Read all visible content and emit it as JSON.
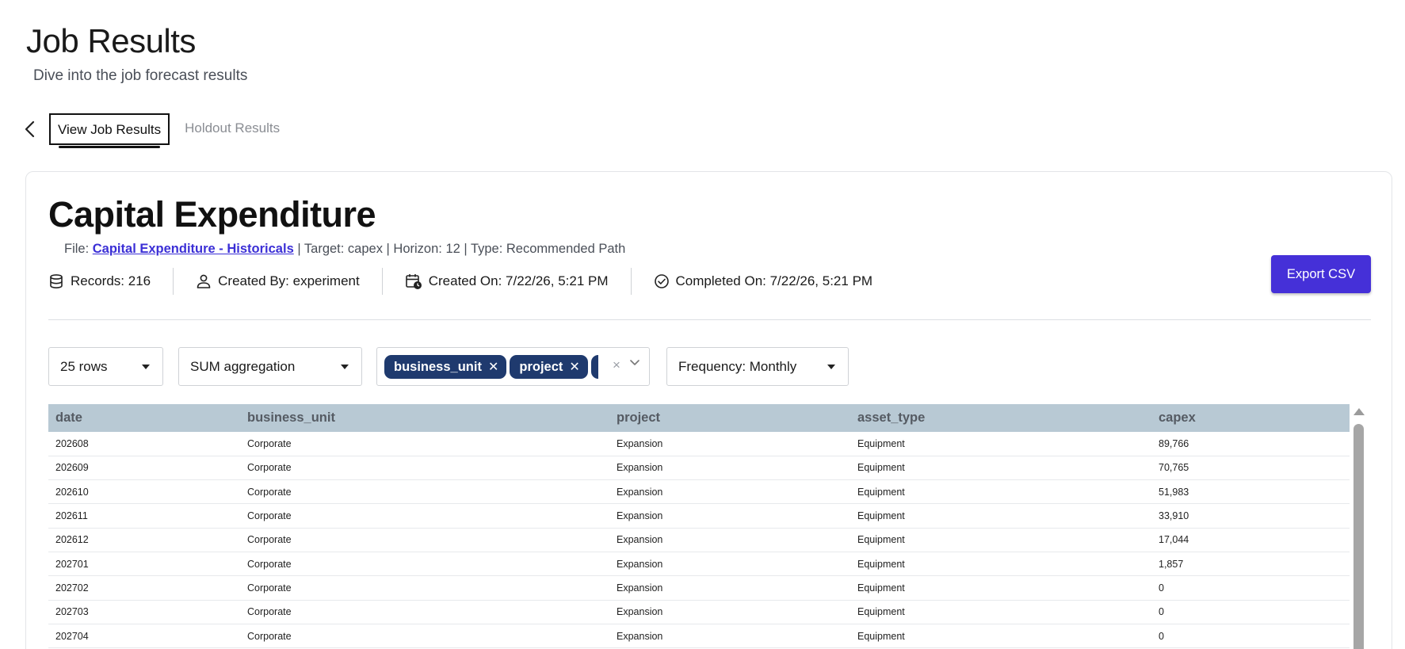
{
  "page": {
    "title": "Job Results",
    "subtitle": "Dive into the job forecast results"
  },
  "tabs": [
    {
      "label": "View Job Results",
      "active": true
    },
    {
      "label": "Holdout Results",
      "active": false
    }
  ],
  "job": {
    "title": "Capital Expenditure",
    "file_prefix": "File: ",
    "file_link": "Capital Expenditure - Historicals",
    "file_suffix": " | Target: capex | Horizon: 12 | Type: Recommended Path",
    "records": "Records: 216",
    "created_by": "Created By: experiment",
    "created_on": "Created On: 7/22/26, 5:21 PM",
    "completed_on": "Completed On: 7/22/26, 5:21 PM",
    "export_label": "Export CSV"
  },
  "controls": {
    "rows": "25 rows",
    "aggregation": "SUM aggregation",
    "group_chips": [
      "business_unit",
      "project",
      "+"
    ],
    "clear": "×",
    "frequency": "Frequency: Monthly"
  },
  "table": {
    "columns": [
      "date",
      "business_unit",
      "project",
      "asset_type",
      "capex"
    ],
    "rows": [
      [
        "202608",
        "Corporate",
        "Expansion",
        "Equipment",
        "89,766"
      ],
      [
        "202609",
        "Corporate",
        "Expansion",
        "Equipment",
        "70,765"
      ],
      [
        "202610",
        "Corporate",
        "Expansion",
        "Equipment",
        "51,983"
      ],
      [
        "202611",
        "Corporate",
        "Expansion",
        "Equipment",
        "33,910"
      ],
      [
        "202612",
        "Corporate",
        "Expansion",
        "Equipment",
        "17,044"
      ],
      [
        "202701",
        "Corporate",
        "Expansion",
        "Equipment",
        "1,857"
      ],
      [
        "202702",
        "Corporate",
        "Expansion",
        "Equipment",
        "0"
      ],
      [
        "202703",
        "Corporate",
        "Expansion",
        "Equipment",
        "0"
      ],
      [
        "202704",
        "Corporate",
        "Expansion",
        "Equipment",
        "0"
      ]
    ]
  },
  "colors": {
    "accent": "#4530d8",
    "chip": "#1f3a6e",
    "table_header": "#b8c9d4",
    "link": "#3b2fd6"
  },
  "icons": [
    "back-arrow-icon",
    "database-icon",
    "user-icon",
    "calendar-clock-icon",
    "check-circle-icon",
    "caret-down-icon",
    "chevron-down-icon",
    "close-icon"
  ]
}
